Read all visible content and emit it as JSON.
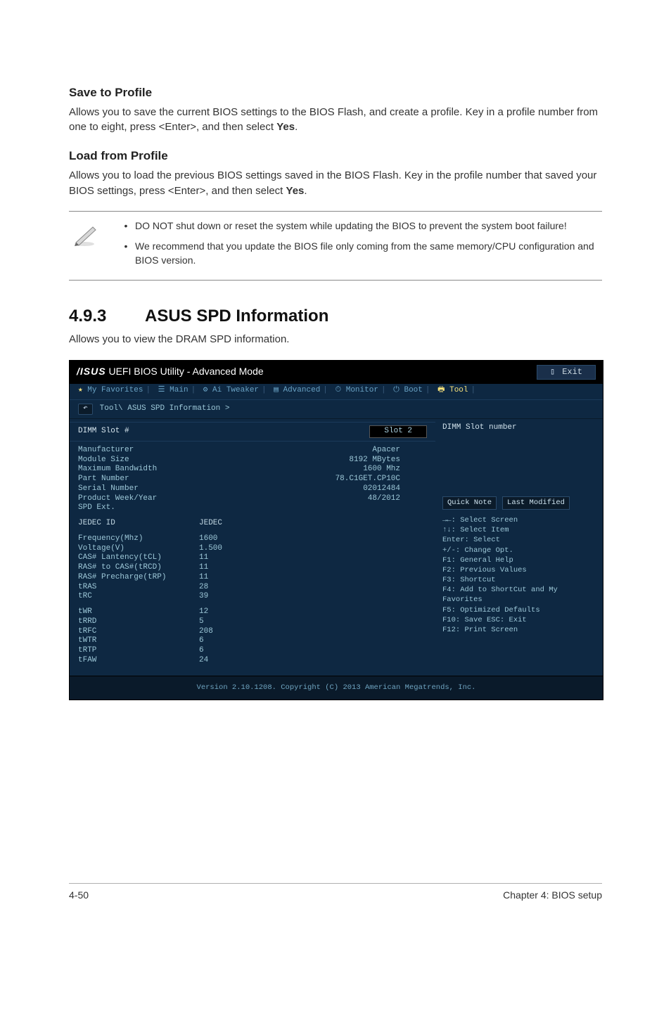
{
  "sections": {
    "save_profile": {
      "heading": "Save to Profile",
      "para": "Allows you to save the current BIOS settings to the BIOS Flash, and create a profile. Key in a profile number from one to eight, press <Enter>, and then select ",
      "para_bold": "Yes",
      "para_end": "."
    },
    "load_profile": {
      "heading": "Load from Profile",
      "para": "Allows you to load the previous BIOS settings saved in the BIOS Flash. Key in the profile number that saved your BIOS settings, press <Enter>, and then select ",
      "para_bold": "Yes",
      "para_end": "."
    },
    "notes": {
      "b1": "DO NOT shut down or reset the system while updating the BIOS to prevent the system boot failure!",
      "b2": "We recommend that you update the BIOS file only coming from the same memory/CPU configuration and BIOS version."
    },
    "spd": {
      "num": "4.9.3",
      "title": "ASUS SPD Information",
      "sub": "Allows you to view the DRAM SPD information."
    }
  },
  "bios": {
    "title_text": "UEFI BIOS Utility - Advanced Mode",
    "exit_label": "Exit",
    "tabs": {
      "fav": "My Favorites",
      "main": "Main",
      "ait": "Ai Tweaker",
      "adv": "Advanced",
      "mon": "Monitor",
      "boot": "Boot",
      "tool": "Tool"
    },
    "breadcrumb": "Tool\\ ASUS SPD Information >",
    "left": {
      "dimm_label": "DIMM Slot #",
      "slot_value": "Slot 2",
      "info": [
        {
          "k": "Manufacturer",
          "v": "Apacer"
        },
        {
          "k": "Module Size",
          "v": "8192 MBytes"
        },
        {
          "k": "Maximum Bandwidth",
          "v": "1600 Mhz"
        },
        {
          "k": "Part Number",
          "v": "78.C1GET.CP10C"
        },
        {
          "k": "Serial Number",
          "v": "02012484"
        },
        {
          "k": "Product Week/Year",
          "v": "48/2012"
        },
        {
          "k": "SPD Ext.",
          "v": ""
        }
      ],
      "jedec": {
        "k": "JEDEC ID",
        "v": "JEDEC"
      },
      "timings": [
        {
          "k": "Frequency(Mhz)",
          "v": "1600"
        },
        {
          "k": "Voltage(V)",
          "v": "1.500"
        },
        {
          "k": "CAS# Lantency(tCL)",
          "v": "11"
        },
        {
          "k": "RAS# to CAS#(tRCD)",
          "v": "11"
        },
        {
          "k": "RAS# Precharge(tRP)",
          "v": "11"
        },
        {
          "k": "tRAS",
          "v": "28"
        },
        {
          "k": "tRC",
          "v": "39"
        }
      ],
      "timings2": [
        {
          "k": "tWR",
          "v": "12"
        },
        {
          "k": "tRRD",
          "v": "5"
        },
        {
          "k": "tRFC",
          "v": "208"
        },
        {
          "k": "tWTR",
          "v": "6"
        },
        {
          "k": "tRTP",
          "v": "6"
        },
        {
          "k": "tFAW",
          "v": "24"
        }
      ]
    },
    "right": {
      "head": "DIMM Slot number",
      "quick": "Quick Note",
      "last": "Last Modified",
      "help": [
        "→←: Select Screen",
        "↑↓: Select Item",
        "Enter: Select",
        "+/-: Change Opt.",
        "F1: General Help",
        "F2: Previous Values",
        "F3: Shortcut",
        "F4: Add to ShortCut and My Favorites",
        "F5: Optimized Defaults",
        "F10: Save  ESC: Exit",
        "F12: Print Screen"
      ]
    },
    "footer": "Version 2.10.1208. Copyright (C) 2013 American Megatrends, Inc."
  },
  "page": {
    "left": "4-50",
    "right": "Chapter 4: BIOS setup"
  }
}
